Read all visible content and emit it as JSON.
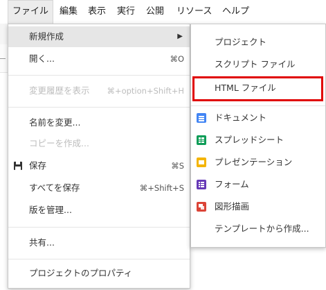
{
  "menubar": {
    "items": [
      "ファイル",
      "編集",
      "表示",
      "実行",
      "公開",
      "リソース",
      "ヘルプ"
    ]
  },
  "file_menu": {
    "items": [
      {
        "label": "新規作成",
        "shortcut": "",
        "disabled": false,
        "submenu": true
      },
      {
        "label": "開く...",
        "shortcut": "⌘O",
        "disabled": false
      },
      {
        "label": "変更履歴を表示",
        "shortcut": "⌘+option+Shift+H",
        "disabled": true
      },
      {
        "label": "名前を変更...",
        "shortcut": "",
        "disabled": false
      },
      {
        "label": "コピーを作成...",
        "shortcut": "",
        "disabled": true
      },
      {
        "label": "保存",
        "shortcut": "⌘S",
        "disabled": false,
        "icon": "save-icon"
      },
      {
        "label": "すべてを保存",
        "shortcut": "⌘+Shift+S",
        "disabled": false
      },
      {
        "label": "版を管理...",
        "shortcut": "",
        "disabled": false
      },
      {
        "label": "共有...",
        "shortcut": "",
        "disabled": false
      },
      {
        "label": "プロジェクトのプロパティ",
        "shortcut": "",
        "disabled": false
      }
    ],
    "submenu_arrow": "▶"
  },
  "new_submenu": {
    "items": [
      {
        "label": "プロジェクト"
      },
      {
        "label": "スクリプト ファイル"
      },
      {
        "label": "HTML ファイル"
      },
      {
        "label": "ドキュメント",
        "icon": "docs-icon",
        "color": "#4285f4"
      },
      {
        "label": "スプレッドシート",
        "icon": "sheets-icon",
        "color": "#0f9d58"
      },
      {
        "label": "プレゼンテーション",
        "icon": "slides-icon",
        "color": "#f4b400"
      },
      {
        "label": "フォーム",
        "icon": "forms-icon",
        "color": "#673ab7"
      },
      {
        "label": "図形描画",
        "icon": "drawings-icon",
        "color": "#db4437"
      },
      {
        "label": "テンプレートから作成..."
      }
    ]
  },
  "colors": {
    "highlight_border": "#e00000",
    "menu_hover": "#e6e6e6",
    "disabled_text": "#bdbdbd"
  }
}
